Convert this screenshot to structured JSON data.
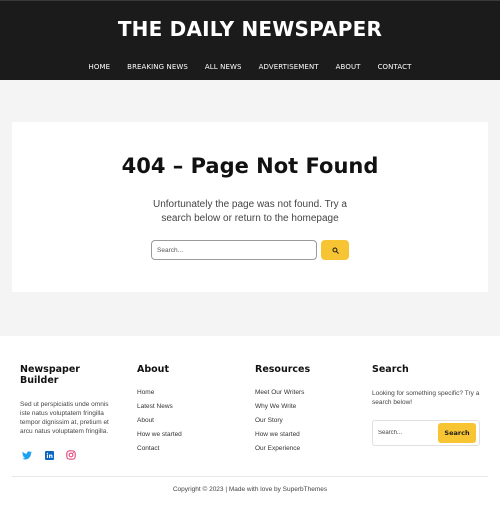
{
  "header": {
    "site_title": "THE DAILY NEWSPAPER",
    "nav": [
      "HOME",
      "BREAKING NEWS",
      "ALL NEWS",
      "ADVERTISEMENT",
      "ABOUT",
      "CONTACT"
    ]
  },
  "main": {
    "title": "404 – Page Not Found",
    "subtitle": "Unfortunately the page was not found. Try a search below or return to the homepage",
    "search": {
      "placeholder": "Search...",
      "button_icon": "search-icon"
    }
  },
  "footer": {
    "about_col": {
      "heading": "Newspaper Builder",
      "text": "Sed ut perspiciatis unde omnis iste natus voluptatem fringilla tempor dignissim at, pretium et arcu natus voluptatem fringilla.",
      "socials": [
        {
          "name": "twitter-icon",
          "color": "#1da1f2"
        },
        {
          "name": "linkedin-icon",
          "color": "#0a66c2"
        },
        {
          "name": "instagram-icon",
          "color": "#e1306c"
        }
      ]
    },
    "about_links": {
      "heading": "About",
      "items": [
        "Home",
        "Latest News",
        "About",
        "How we started",
        "Contact"
      ]
    },
    "resources": {
      "heading": "Resources",
      "items": [
        "Meet Our Writers",
        "Why We Write",
        "Our Story",
        "How we started",
        "Our Experience"
      ]
    },
    "search": {
      "heading": "Search",
      "text": "Looking for something specific? Try a search below!",
      "placeholder": "Search...",
      "button": "Search"
    },
    "copyright": "Copyright © 2023 | Made with love by SuperbThemes"
  },
  "colors": {
    "header_bg": "#1b1b1b",
    "accent": "#f7c433",
    "main_bg": "#f4f4f4"
  }
}
